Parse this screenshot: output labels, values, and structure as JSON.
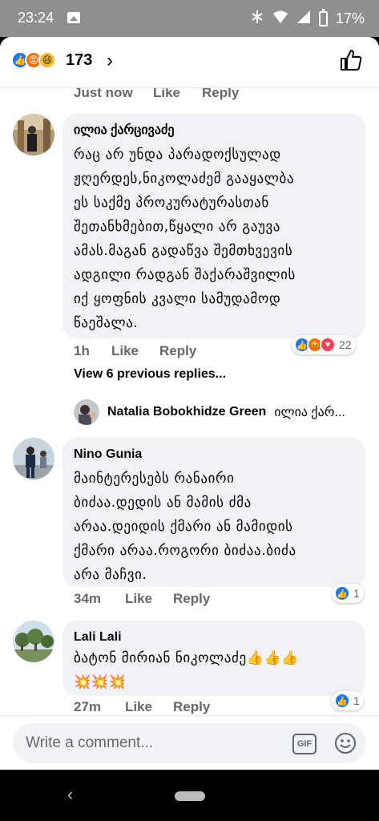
{
  "status_bar": {
    "time": "23:24",
    "battery": "17%"
  },
  "header": {
    "reaction_count": "173",
    "chevron": "›"
  },
  "top_meta": {
    "time": "Just now",
    "like": "Like",
    "reply": "Reply"
  },
  "comments": [
    {
      "author": "ილია ქარცივაძე",
      "text": "რაც არ უნდა პარადოქსულად\nჟღერდეს,ნიკოლაძემ გააყალბა\nეს საქმე პროკურატურასთან\nშეთანხმებით,წყალი არ გაუვა\nამას.მაგან გადაწვა შემთხვევის\nადგილი რადგან შაქარაშვილის\nიქ ყოფნის კვალი სამუდამოდ\nწაეშალა.",
      "time": "1h",
      "like": "Like",
      "reply": "Reply",
      "reaction_count": "22"
    },
    {
      "author": "Nino Gunia",
      "text": "მაინტერესებს რანაირი\nბიძაა.დედის ან მამის ძმა\nარაა.დეიდის ქმარი ან მამიდის\nქმარი არაა.როგორი ბიძაა.ბიძა\nარა მაჩვი.",
      "time": "34m",
      "like": "Like",
      "reply": "Reply",
      "reaction_count": "1"
    },
    {
      "author": "Lali Lali",
      "text": "ბატონ მირიან ნიკოლაძე👍👍👍\n💥💥💥",
      "time": "27m",
      "like": "Like",
      "reply": "Reply",
      "reaction_count": "1"
    }
  ],
  "replies": {
    "view_previous": "View 6 previous replies...",
    "preview_author": "Natalia Bobokhidze Green",
    "preview_text": "ილია ქარ..."
  },
  "composer": {
    "placeholder": "Write a comment...",
    "gif_label": "GIF"
  },
  "navigation": {
    "back": "‹"
  },
  "colors": {
    "facebook_blue": "#1877f2",
    "bubble_bg": "#f0f2f5",
    "meta_grey": "#65676b"
  }
}
